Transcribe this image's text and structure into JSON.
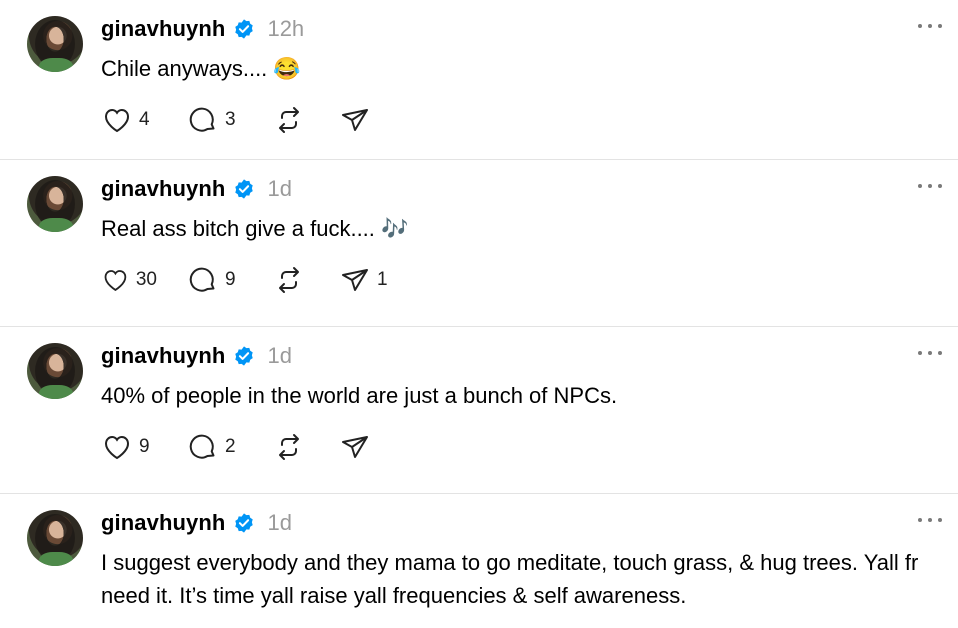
{
  "posts": [
    {
      "username": "ginavhuynh",
      "time": "12h",
      "text": "Chile anyways.... 😂",
      "likes": "4",
      "replies": "3",
      "reposts": "",
      "shares": ""
    },
    {
      "username": "ginavhuynh",
      "time": "1d",
      "text": "Real ass bitch give a fuck.... 🎶",
      "likes": "30",
      "replies": "9",
      "reposts": "",
      "shares": "1"
    },
    {
      "username": "ginavhuynh",
      "time": "1d",
      "text": "40% of people in the world are just a bunch of NPCs.",
      "likes": "9",
      "replies": "2",
      "reposts": "",
      "shares": ""
    },
    {
      "username": "ginavhuynh",
      "time": "1d",
      "text": "I suggest everybody and they mama to go meditate, touch grass, & hug trees. Yall fr need it. It’s time yall raise yall frequencies & self awareness.",
      "likes": "",
      "replies": "",
      "reposts": "",
      "shares": ""
    }
  ],
  "icons": {
    "verified": "verified-badge-icon",
    "like": "heart-icon",
    "reply": "speech-bubble-icon",
    "repost": "repost-icon",
    "share": "send-icon",
    "more": "more-options-icon"
  },
  "colors": {
    "verified": "#0095f6",
    "muted": "#9a9a9a"
  }
}
